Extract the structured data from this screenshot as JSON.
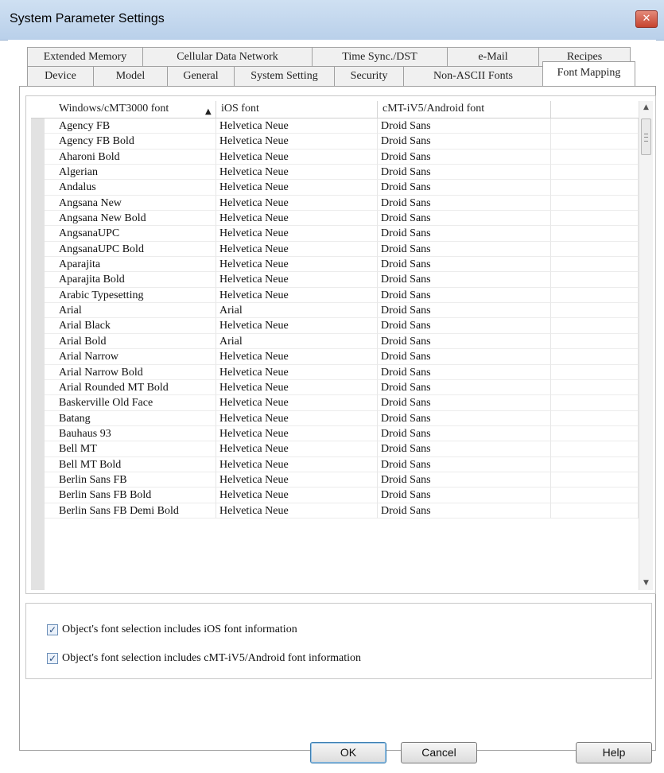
{
  "window": {
    "title": "System Parameter Settings"
  },
  "tabs": {
    "row1": [
      {
        "label": "Extended Memory",
        "w": 146
      },
      {
        "label": "Cellular Data Network",
        "w": 214
      },
      {
        "label": "Time Sync./DST",
        "w": 171
      },
      {
        "label": "e-Mail",
        "w": 116
      },
      {
        "label": "Recipes",
        "w": 116
      }
    ],
    "row2": [
      {
        "label": "Device",
        "w": 84
      },
      {
        "label": "Model",
        "w": 94
      },
      {
        "label": "General",
        "w": 85
      },
      {
        "label": "System Setting",
        "w": 127
      },
      {
        "label": "Security",
        "w": 88
      },
      {
        "label": "Non-ASCII Fonts",
        "w": 176
      },
      {
        "label": "Font Mapping",
        "w": 117,
        "active": true
      }
    ]
  },
  "grid": {
    "columns": [
      "Windows/cMT3000 font",
      "iOS font",
      "cMT-iV5/Android font"
    ],
    "sort_indicator": "▲",
    "rows": [
      [
        "Agency FB",
        "Helvetica Neue",
        "Droid Sans"
      ],
      [
        "Agency FB Bold",
        "Helvetica Neue",
        "Droid Sans"
      ],
      [
        "Aharoni Bold",
        "Helvetica Neue",
        "Droid Sans"
      ],
      [
        "Algerian",
        "Helvetica Neue",
        "Droid Sans"
      ],
      [
        "Andalus",
        "Helvetica Neue",
        "Droid Sans"
      ],
      [
        "Angsana New",
        "Helvetica Neue",
        "Droid Sans"
      ],
      [
        "Angsana New Bold",
        "Helvetica Neue",
        "Droid Sans"
      ],
      [
        "AngsanaUPC",
        "Helvetica Neue",
        "Droid Sans"
      ],
      [
        "AngsanaUPC Bold",
        "Helvetica Neue",
        "Droid Sans"
      ],
      [
        "Aparajita",
        "Helvetica Neue",
        "Droid Sans"
      ],
      [
        "Aparajita Bold",
        "Helvetica Neue",
        "Droid Sans"
      ],
      [
        "Arabic Typesetting",
        "Helvetica Neue",
        "Droid Sans"
      ],
      [
        "Arial",
        "Arial",
        "Droid Sans"
      ],
      [
        "Arial Black",
        "Helvetica Neue",
        "Droid Sans"
      ],
      [
        "Arial Bold",
        "Arial",
        "Droid Sans"
      ],
      [
        "Arial Narrow",
        "Helvetica Neue",
        "Droid Sans"
      ],
      [
        "Arial Narrow Bold",
        "Helvetica Neue",
        "Droid Sans"
      ],
      [
        "Arial Rounded MT Bold",
        "Helvetica Neue",
        "Droid Sans"
      ],
      [
        "Baskerville Old Face",
        "Helvetica Neue",
        "Droid Sans"
      ],
      [
        "Batang",
        "Helvetica Neue",
        "Droid Sans"
      ],
      [
        "Bauhaus 93",
        "Helvetica Neue",
        "Droid Sans"
      ],
      [
        "Bell MT",
        "Helvetica Neue",
        "Droid Sans"
      ],
      [
        "Bell MT Bold",
        "Helvetica Neue",
        "Droid Sans"
      ],
      [
        "Berlin Sans FB",
        "Helvetica Neue",
        "Droid Sans"
      ],
      [
        "Berlin Sans FB Bold",
        "Helvetica Neue",
        "Droid Sans"
      ],
      [
        "Berlin Sans FB Demi Bold",
        "Helvetica Neue",
        "Droid Sans"
      ]
    ]
  },
  "options": {
    "ios_checkbox": {
      "label": "Object's font selection includes iOS font information",
      "checked": true
    },
    "android_checkbox": {
      "label": "Object's font selection includes cMT-iV5/Android font information",
      "checked": true
    }
  },
  "buttons": {
    "ok": "OK",
    "cancel": "Cancel",
    "help": "Help"
  },
  "icons": {
    "close": "close-icon",
    "check": "check-icon",
    "scroll_up": "arrow-up-icon",
    "scroll_down": "arrow-down-icon",
    "sort": "sort-ascending-icon"
  }
}
